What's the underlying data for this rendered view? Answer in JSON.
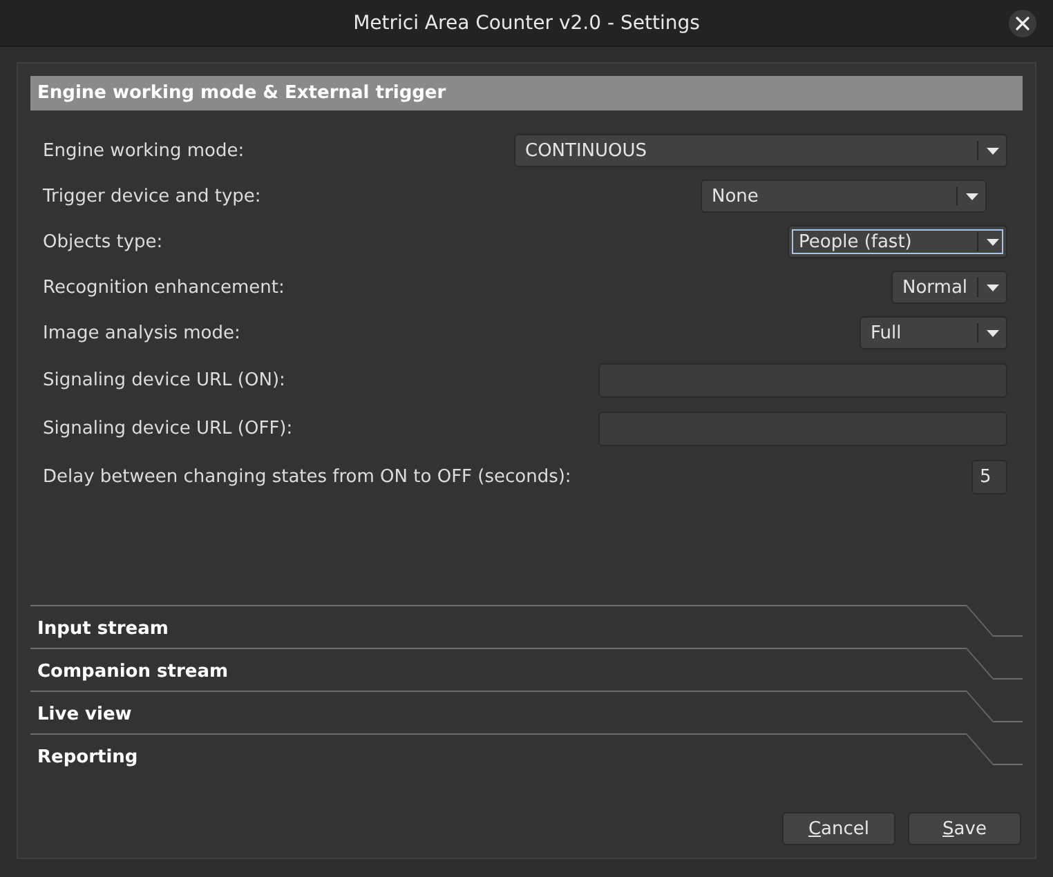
{
  "window": {
    "title": "Metrici Area Counter v2.0 - Settings"
  },
  "sections": [
    {
      "title": "Engine working mode & External trigger",
      "expanded": true,
      "fields": [
        {
          "kind": "dropdown",
          "label": "Engine working mode:",
          "value": "CONTINUOUS",
          "focused": false
        },
        {
          "kind": "dropdown",
          "label": "Trigger device and type:",
          "value": "None",
          "focused": false
        },
        {
          "kind": "dropdown",
          "label": "Objects type:",
          "value": "People (fast)",
          "focused": true
        },
        {
          "kind": "dropdown",
          "label": "Recognition enhancement:",
          "value": "Normal",
          "focused": false
        },
        {
          "kind": "dropdown",
          "label": "Image analysis mode:",
          "value": "Full",
          "focused": false
        },
        {
          "kind": "text",
          "label": "Signaling device URL (ON):",
          "focused": false
        },
        {
          "kind": "text",
          "label": "Signaling device URL (OFF):",
          "focused": false
        },
        {
          "kind": "number",
          "label": "Delay between changing states from ON to OFF (seconds):",
          "value": "5",
          "focused": false
        }
      ]
    },
    {
      "title": "Input stream",
      "expanded": false
    },
    {
      "title": "Companion stream",
      "expanded": false
    },
    {
      "title": "Live view",
      "expanded": false
    },
    {
      "title": "Reporting",
      "expanded": false
    }
  ],
  "buttons": [
    {
      "label": "Cancel",
      "mnemonic": true
    },
    {
      "label": "Save",
      "mnemonic": true
    }
  ]
}
